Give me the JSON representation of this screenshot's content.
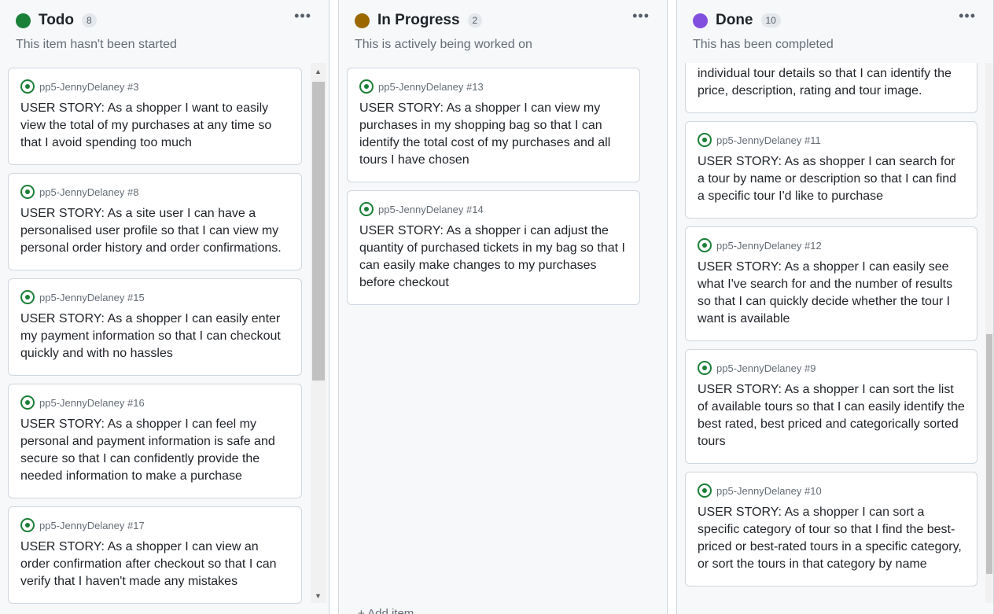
{
  "columns": [
    {
      "title": "Todo",
      "count": "8",
      "color": "#1a7f37",
      "description": "This item hasn't been started",
      "cards": [
        {
          "ref": "pp5-JennyDelaney #3",
          "text": "USER STORY: As a shopper I want to easily view the total of my purchases at any time so that I avoid spending too much"
        },
        {
          "ref": "pp5-JennyDelaney #8",
          "text": "USER STORY: As a site user I can have a personalised user profile so that I can view my personal order history and order confirmations."
        },
        {
          "ref": "pp5-JennyDelaney #15",
          "text": "USER STORY: As a shopper I can easily enter my payment information so that I can checkout quickly and with no hassles"
        },
        {
          "ref": "pp5-JennyDelaney #16",
          "text": "USER STORY: As a shopper I can feel my personal and payment information is safe and secure so that I can confidently provide the needed information to make a purchase"
        },
        {
          "ref": "pp5-JennyDelaney #17",
          "text": "USER STORY: As a shopper I can view an order confirmation after checkout so that I can verify that I haven't made any mistakes"
        }
      ]
    },
    {
      "title": "In Progress",
      "count": "2",
      "color": "#9a6700",
      "description": "This is actively being worked on",
      "cards": [
        {
          "ref": "pp5-JennyDelaney #13",
          "text": "USER STORY: As a shopper I can view my purchases in my shopping bag so that I can identify the total cost of my purchases and all tours I have chosen"
        },
        {
          "ref": "pp5-JennyDelaney #14",
          "text": "USER STORY: As a shopper i can adjust the quantity of purchased tickets in my bag so that I can easily make changes to my purchases before checkout"
        }
      ],
      "add_item": "+ Add item"
    },
    {
      "title": "Done",
      "count": "10",
      "color": "#8250df",
      "description": "This has been completed",
      "cards": [
        {
          "ref": "",
          "text": "USER STORY: As a shopper I can view individual tour details so that I can identify the price, description, rating and tour image."
        },
        {
          "ref": "pp5-JennyDelaney #11",
          "text": "USER STORY: As as shopper I can search for a tour by name or description so that I can find a specific tour I'd like to purchase"
        },
        {
          "ref": "pp5-JennyDelaney #12",
          "text": "USER STORY: As a shopper I can easily see what I've search for and the number of results so that I can quickly decide whether the tour I want is available"
        },
        {
          "ref": "pp5-JennyDelaney #9",
          "text": "USER STORY: As a shopper I can sort the list of available tours so that I can easily identify the best rated, best priced and categorically sorted tours"
        },
        {
          "ref": "pp5-JennyDelaney #10",
          "text": "USER STORY: As a shopper I can sort a specific category of tour so that I find the best-priced or best-rated tours in a specific category, or sort the tours in that category by name"
        }
      ]
    }
  ]
}
